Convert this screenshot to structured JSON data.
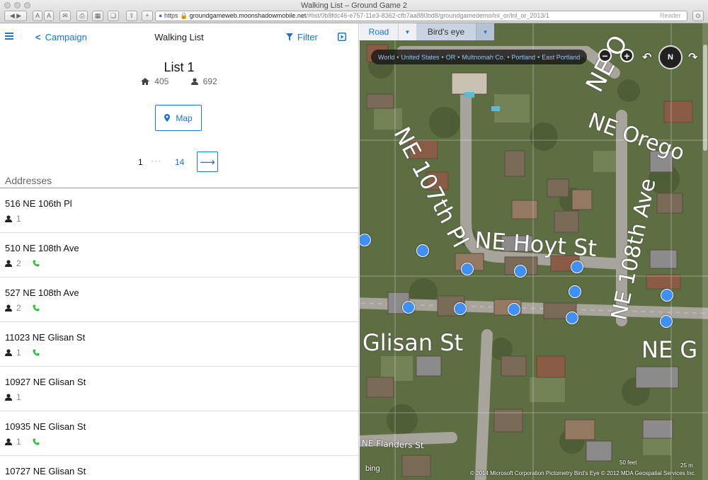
{
  "browser": {
    "window_title": "Walking List – Ground Game 2",
    "url_scheme": "https",
    "url_host": "groundgameweb.moonshadowmobile.net",
    "url_path": "/#list/0b8fdc46-e757-11e3-8362-cfb7aa880bd8/groundgamedemo/lnl_or/lnl_or_2013/1",
    "reader_label": "Reader"
  },
  "header": {
    "back_label": "Campaign",
    "title": "Walking List",
    "filter_label": "Filter"
  },
  "list": {
    "title": "List 1",
    "households": "405",
    "people": "692",
    "map_button": "Map"
  },
  "pager": {
    "current": "1",
    "ellipsis": "···",
    "last": "14",
    "next_symbol": "⟶"
  },
  "addresses": {
    "heading": "Addresses",
    "items": [
      {
        "street": "516 NE 106th Pl",
        "people": "1",
        "has_phone": false
      },
      {
        "street": "510 NE 108th Ave",
        "people": "2",
        "has_phone": true
      },
      {
        "street": "527 NE 108th Ave",
        "people": "2",
        "has_phone": true
      },
      {
        "street": "11023 NE Glisan St",
        "people": "1",
        "has_phone": true
      },
      {
        "street": "10927 NE Glisan St",
        "people": "1",
        "has_phone": false
      },
      {
        "street": "10935 NE Glisan St",
        "people": "1",
        "has_phone": true
      },
      {
        "street": "10727 NE Glisan St",
        "people": "",
        "has_phone": false
      }
    ]
  },
  "map": {
    "tabs": {
      "road": "Road",
      "birds_eye": "Bird's eye",
      "active": "birds_eye"
    },
    "breadcrumbs": [
      "World",
      "United States",
      "OR",
      "Multnomah Co.",
      "Portland",
      "East Portland"
    ],
    "compass_label": "N",
    "street_labels": {
      "oregon": "NE Orego",
      "ne_top": "NE O",
      "st107": "NE 107th Pl",
      "hoyt": "NE Hoyt St",
      "ave108": "NE 108th Ave",
      "glisan": "Glisan St",
      "ne_g": "NE G",
      "flanders": "NE Flanders St"
    },
    "bing_label": "bing",
    "copyright": "© 2014 Microsoft Corporation   Pictometry Bird's Eye © 2012 MDA Geospatial Services Inc.",
    "scale_label": "50 feet",
    "scale_label_metric": "25 m",
    "colors": {
      "pin": "#3f8ff5",
      "accent": "#1b74d6",
      "phone": "#2fbf3a"
    }
  }
}
